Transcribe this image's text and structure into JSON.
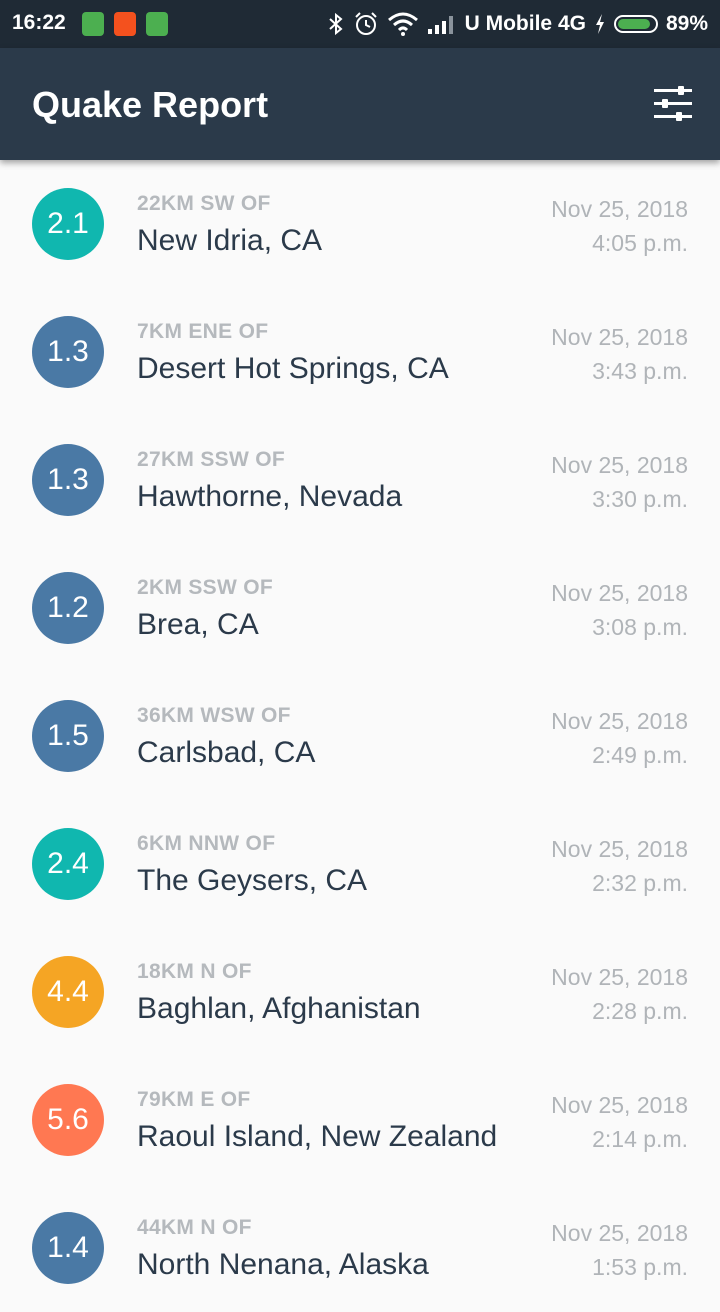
{
  "status_bar": {
    "time": "16:22",
    "carrier": "U Mobile 4G",
    "battery_percent": "89%",
    "battery_level": 0.89,
    "icons": [
      "notification-sim-icon",
      "notification-app-icon",
      "notification-android-icon",
      "bluetooth-icon",
      "alarm-icon",
      "wifi-icon",
      "signal-icon",
      "charging-icon",
      "battery-icon"
    ]
  },
  "app_bar": {
    "title": "Quake Report",
    "filter_icon": "settings-sliders-icon"
  },
  "colors": {
    "mag_1": "#4a79a5",
    "mag_2": "#10b7af",
    "mag_4": "#f5a524",
    "mag_5": "#ff7852"
  },
  "earthquakes": [
    {
      "magnitude": "2.1",
      "offset": "22KM SW OF",
      "place": "New Idria, CA",
      "date": "Nov 25, 2018",
      "time": "4:05 p.m.",
      "color": "#10b7af"
    },
    {
      "magnitude": "1.3",
      "offset": "7KM ENE OF",
      "place": "Desert Hot Springs, CA",
      "date": "Nov 25, 2018",
      "time": "3:43 p.m.",
      "color": "#4a79a5"
    },
    {
      "magnitude": "1.3",
      "offset": "27KM SSW OF",
      "place": "Hawthorne, Nevada",
      "date": "Nov 25, 2018",
      "time": "3:30 p.m.",
      "color": "#4a79a5"
    },
    {
      "magnitude": "1.2",
      "offset": "2KM SSW OF",
      "place": "Brea, CA",
      "date": "Nov 25, 2018",
      "time": "3:08 p.m.",
      "color": "#4a79a5"
    },
    {
      "magnitude": "1.5",
      "offset": "36KM WSW OF",
      "place": "Carlsbad, CA",
      "date": "Nov 25, 2018",
      "time": "2:49 p.m.",
      "color": "#4a79a5"
    },
    {
      "magnitude": "2.4",
      "offset": "6KM NNW OF",
      "place": "The Geysers, CA",
      "date": "Nov 25, 2018",
      "time": "2:32 p.m.",
      "color": "#10b7af"
    },
    {
      "magnitude": "4.4",
      "offset": "18KM N OF",
      "place": "Baghlan, Afghanistan",
      "date": "Nov 25, 2018",
      "time": "2:28 p.m.",
      "color": "#f5a524"
    },
    {
      "magnitude": "5.6",
      "offset": "79KM E OF",
      "place": "Raoul Island, New Zealand",
      "date": "Nov 25, 2018",
      "time": "2:14 p.m.",
      "color": "#ff7852"
    },
    {
      "magnitude": "1.4",
      "offset": "44KM N OF",
      "place": "North Nenana, Alaska",
      "date": "Nov 25, 2018",
      "time": "1:53 p.m.",
      "color": "#4a79a5"
    }
  ]
}
